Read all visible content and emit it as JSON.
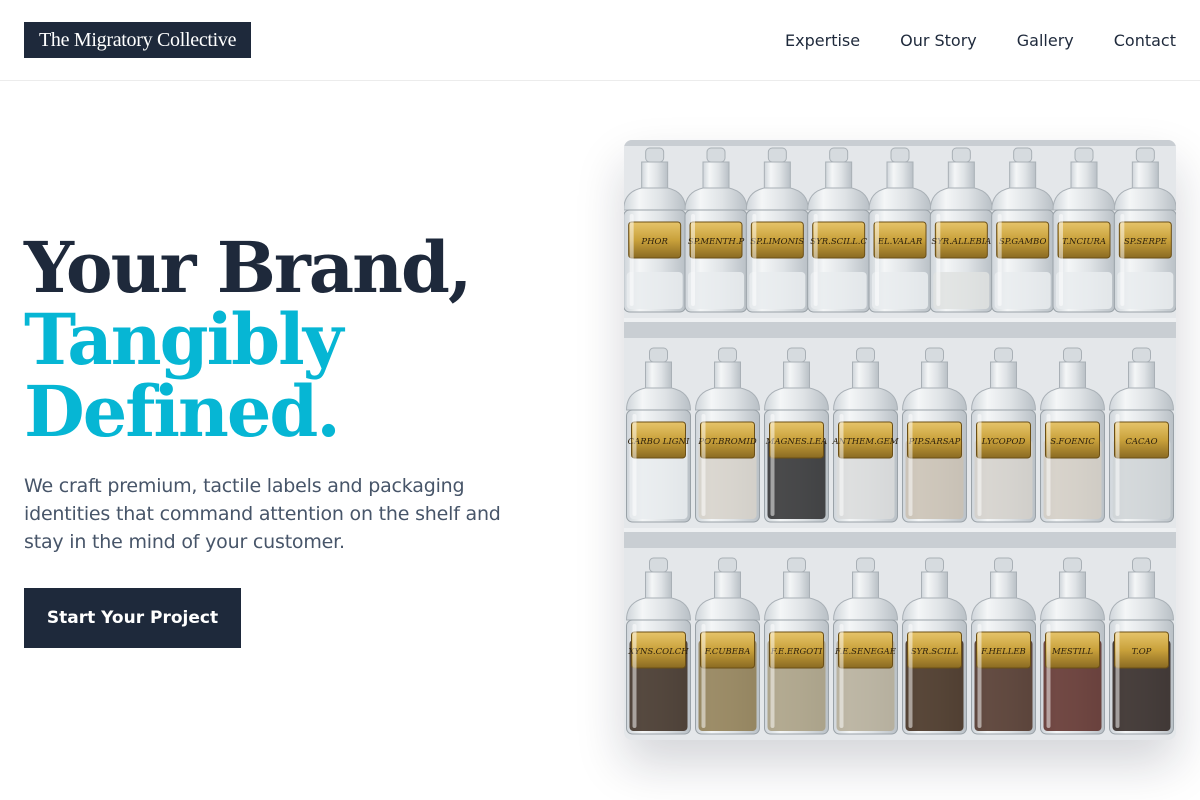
{
  "header": {
    "logo_text": "The Migratory Collective",
    "nav": [
      {
        "label": "Expertise"
      },
      {
        "label": "Our Story"
      },
      {
        "label": "Gallery"
      },
      {
        "label": "Contact"
      }
    ]
  },
  "hero": {
    "title_line1": "Your Brand,",
    "title_line2": "Tangibly",
    "title_line3": "Defined.",
    "subtitle": "We craft premium, tactile labels and packaging identities that command attention on the shelf and stay in the mind of your customer.",
    "cta_label": "Start Your Project",
    "image_alt": "Apothecary glass bottles with gold labels on shelves"
  },
  "image_labels": {
    "row1": [
      "PHOR",
      "SP.MENTH.P",
      "SP.LIMONIS",
      "SYR.SCILL.C",
      "EL.VALAR",
      "SYR.ALLEBIA",
      "SP.GAMBO",
      "T.NCIURA",
      "SP.SERPE"
    ],
    "row2": [
      "CARBO LIGNI",
      "POT.BROMID",
      "MAGNES.LEA",
      "ANTHEM.GEM",
      "PIP.SARSAP",
      "LYCOPOD",
      "S.FOENIC",
      "CACAO"
    ],
    "row3": [
      "XYNS.COLCH",
      "F.CUBEBA",
      "F.E.ERGOTI",
      "F.E.SENEGAE",
      "SYR.SCILL",
      "F.HELLEB",
      "MESTILL",
      "T.OP"
    ]
  },
  "colors": {
    "navy": "#1e293b",
    "accent": "#06b6d4",
    "muted_text": "#475569",
    "label_gold": "#c9a13b"
  }
}
